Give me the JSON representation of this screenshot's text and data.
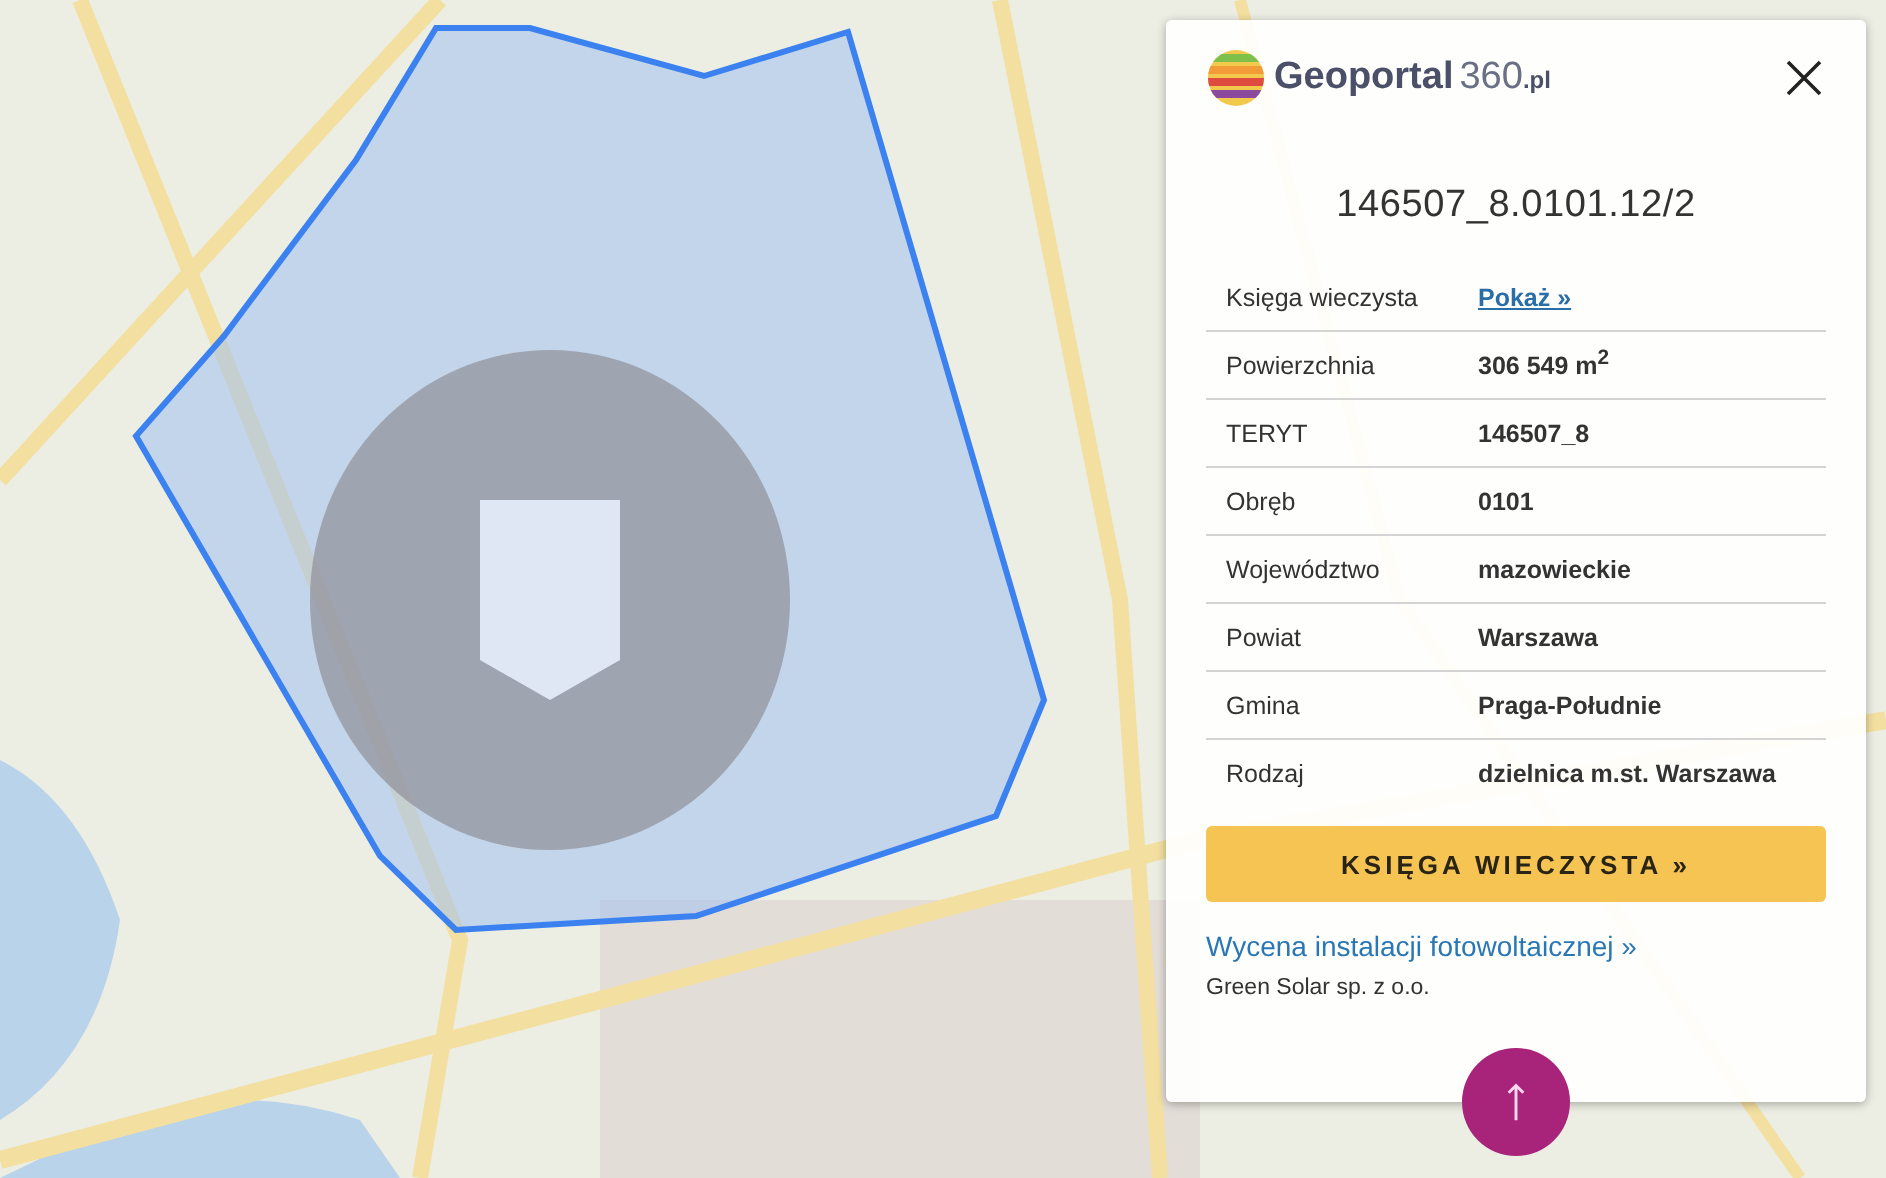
{
  "panel": {
    "logo": {
      "name": "Geoportal",
      "number": "360",
      "domain": ".pl"
    },
    "parcel_id": "146507_8.0101.12/2",
    "rows": [
      {
        "kind": "link",
        "label": "Księga wieczysta",
        "value": "Pokaż »"
      },
      {
        "kind": "text",
        "label": "Powierzchnia",
        "value": "306 549 m$^{2}$"
      },
      {
        "kind": "text",
        "label": "TERYT",
        "value": "146507_8"
      },
      {
        "kind": "text",
        "label": "Obręb",
        "value": "0101"
      },
      {
        "kind": "text",
        "label": "Województwo",
        "value": "mazowieckie"
      },
      {
        "kind": "text",
        "label": "Powiat",
        "value": "Warszawa"
      },
      {
        "kind": "text",
        "label": "Gmina",
        "value": "Praga-Południe"
      },
      {
        "kind": "text",
        "label": "Rodzaj",
        "value": "dzielnica m.st. Warszawa"
      }
    ],
    "button": "KSIĘGA WIECZYSTA »",
    "promo": {
      "link": "Wycena instalacji fotowoltaicznej »",
      "company": "Green Solar sp. z o.o."
    }
  }
}
